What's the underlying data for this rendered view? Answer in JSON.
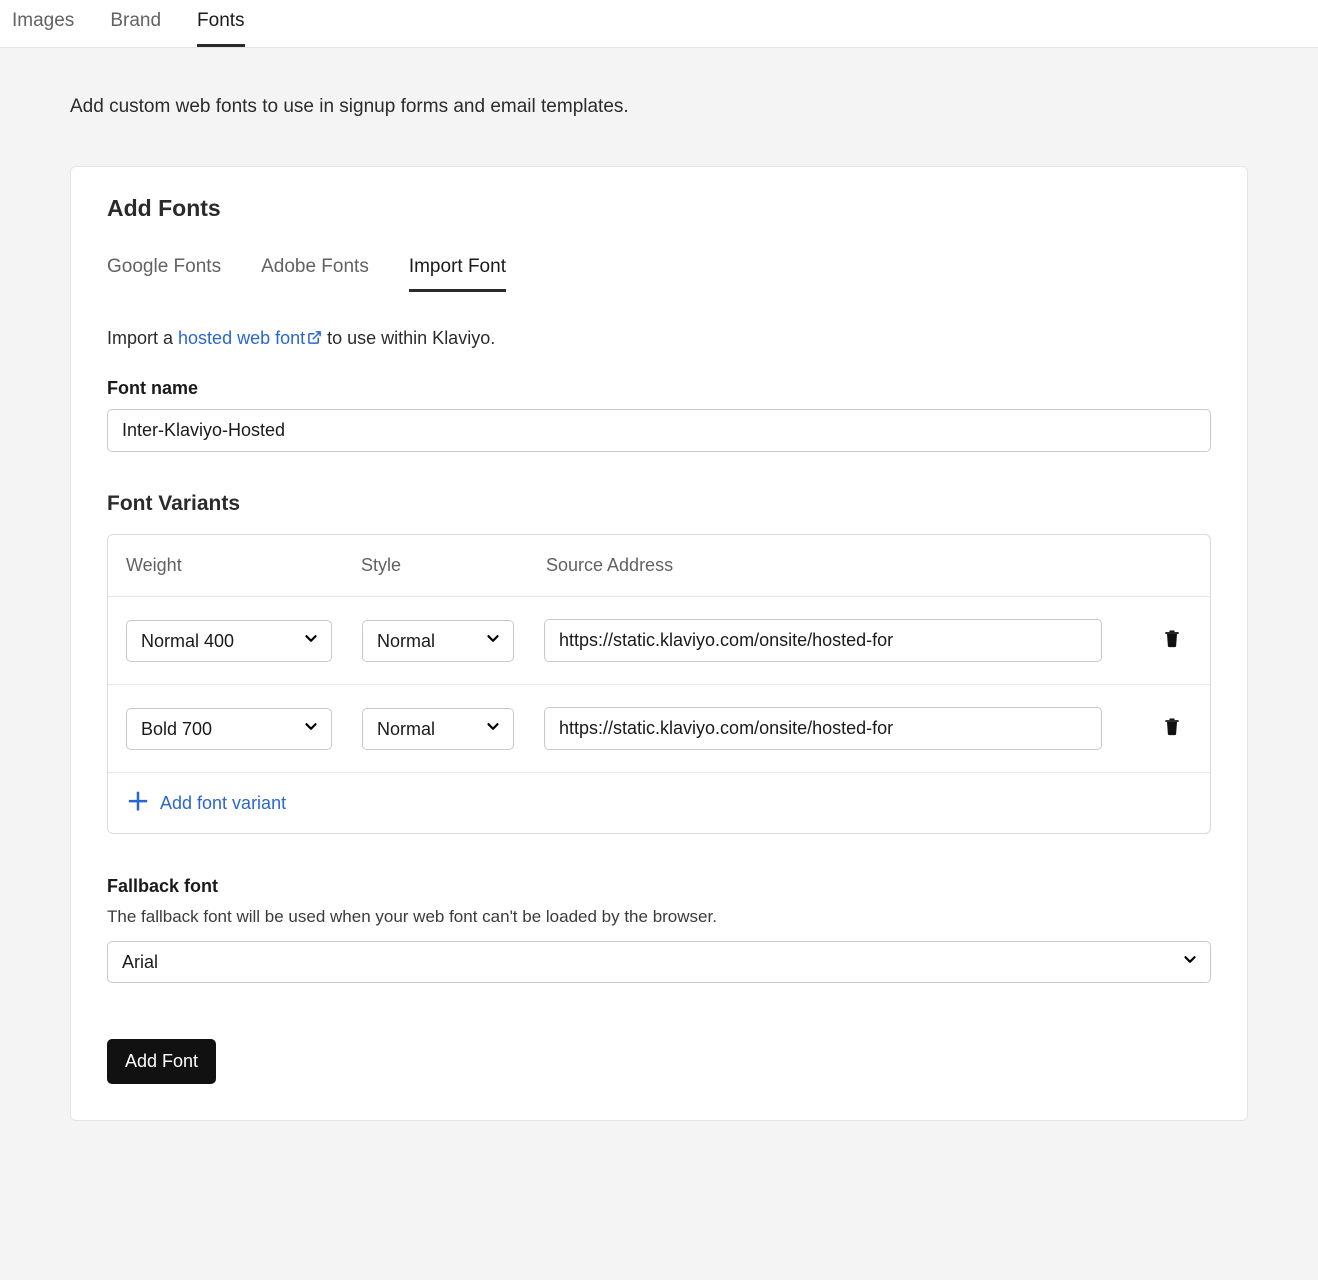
{
  "topTabs": {
    "images": "Images",
    "brand": "Brand",
    "fonts": "Fonts"
  },
  "page": {
    "description": "Add custom web fonts to use in signup forms and email templates."
  },
  "card": {
    "title": "Add Fonts"
  },
  "subTabs": {
    "google": "Google Fonts",
    "adobe": "Adobe Fonts",
    "import": "Import Font"
  },
  "importLine": {
    "prefix": "Import a ",
    "linkText": "hosted web font",
    "suffix": " to use within Klaviyo."
  },
  "fontName": {
    "label": "Font name",
    "value": "Inter-Klaviyo-Hosted"
  },
  "variants": {
    "heading": "Font Variants",
    "headers": {
      "weight": "Weight",
      "style": "Style",
      "source": "Source Address"
    },
    "rows": [
      {
        "weight": "Normal 400",
        "style": "Normal",
        "source": "https://static.klaviyo.com/onsite/hosted-for"
      },
      {
        "weight": "Bold 700",
        "style": "Normal",
        "source": "https://static.klaviyo.com/onsite/hosted-for"
      }
    ],
    "addLabel": "Add font variant"
  },
  "fallback": {
    "label": "Fallback font",
    "hint": "The fallback font will be used when your web font can't be loaded by the browser.",
    "value": "Arial"
  },
  "submit": {
    "label": "Add Font"
  }
}
